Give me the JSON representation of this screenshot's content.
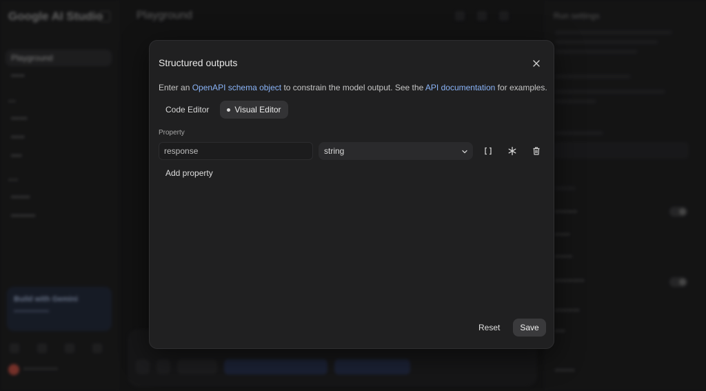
{
  "background": {
    "logo": "Google AI Studio",
    "active_nav": "Playground",
    "main_title": "Playground",
    "right_panel_title": "Run settings",
    "promo_title": "Build with Gemini"
  },
  "modal": {
    "title": "Structured outputs",
    "description": {
      "part1": "Enter an ",
      "link1": "OpenAPI schema object",
      "part2": " to constrain the model output. See the ",
      "link2": "API documentation",
      "part3": " for examples."
    },
    "tabs": [
      {
        "label": "Code Editor",
        "active": false
      },
      {
        "label": "Visual Editor",
        "active": true
      }
    ],
    "property_label": "Property",
    "property_value": "response",
    "type_value": "string",
    "add_property_label": "Add property",
    "reset_label": "Reset",
    "save_label": "Save"
  },
  "icons": {
    "close": "close-icon",
    "dropdown": "chevron-down-icon",
    "array": "brackets-icon",
    "required": "asterisk-icon",
    "delete": "trash-icon"
  },
  "colors": {
    "link": "#8ab4f8",
    "modal_bg": "#202021",
    "page_bg": "#1c1c1d"
  }
}
